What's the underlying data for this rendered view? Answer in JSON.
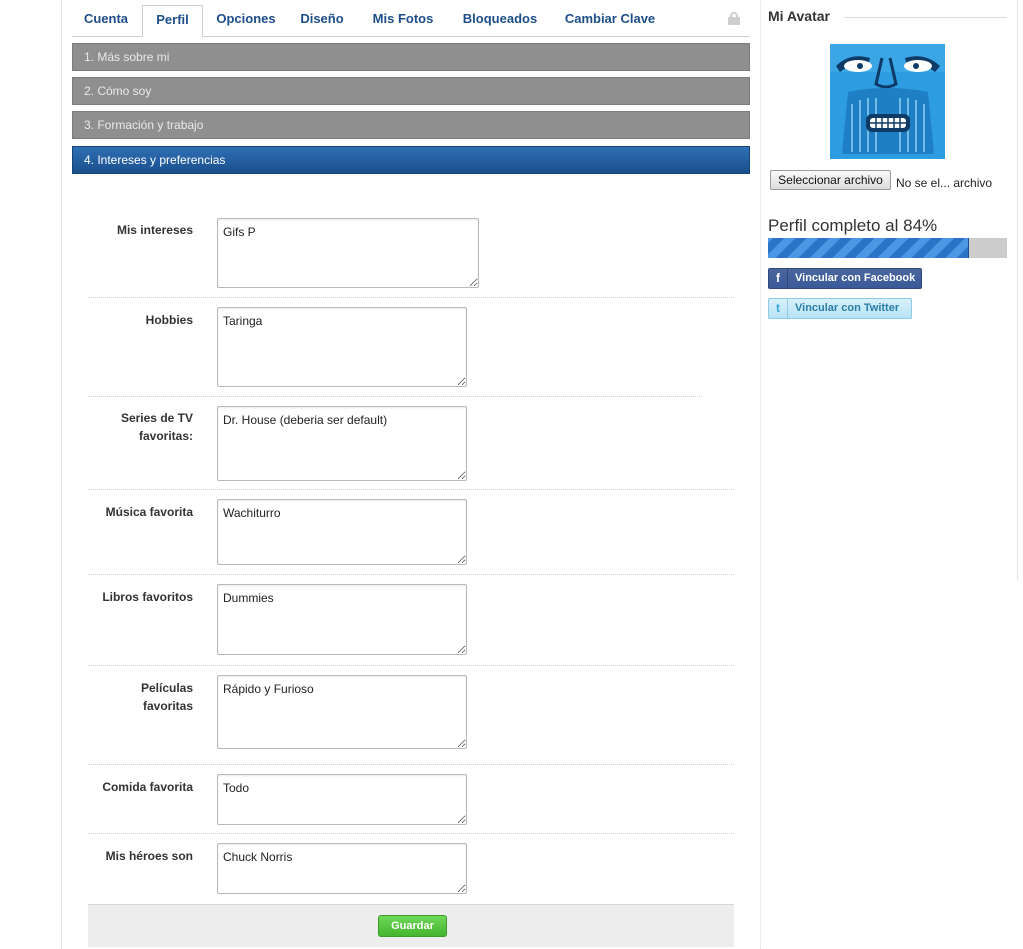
{
  "tabs": [
    {
      "label": "Cuenta"
    },
    {
      "label": "Perfil",
      "active": true
    },
    {
      "label": "Opciones"
    },
    {
      "label": "Diseño"
    },
    {
      "label": "Mis Fotos"
    },
    {
      "label": "Bloqueados"
    },
    {
      "label": "Cambiar Clave"
    }
  ],
  "accordion": [
    {
      "label": "1. Más sobre mi"
    },
    {
      "label": "2. Cómo soy"
    },
    {
      "label": "3. Formación y trabajo"
    },
    {
      "label": "4. Intereses y preferencias",
      "open": true
    }
  ],
  "form": {
    "fields": [
      {
        "label": "Mis intereses",
        "value": "Gifs P"
      },
      {
        "label": "Hobbies",
        "value": "Taringa"
      },
      {
        "label": "Series de TV favoritas:",
        "value": "Dr. House (deberia ser default)"
      },
      {
        "label": "Música favorita",
        "value": "Wachiturro"
      },
      {
        "label": "Libros favoritos",
        "value": "Dummies"
      },
      {
        "label": "Películas favoritas",
        "value": "Rápido y Furioso"
      },
      {
        "label": "Comida favorita",
        "value": "Todo"
      },
      {
        "label": "Mis héroes son",
        "value": "Chuck Norris"
      }
    ],
    "save_label": "Guardar"
  },
  "sidebar": {
    "title": "Mi Avatar",
    "file_button": "Seleccionar archivo",
    "file_status": "No se el... archivo",
    "progress_label": "Perfil completo al 84%",
    "progress_fraction": 0.84,
    "facebook_label": "Vincular con Facebook",
    "twitter_label": "Vincular con Twitter"
  },
  "colors": {
    "tab_text": "#1d4e89",
    "accordion_closed": "#8f8f8f",
    "accordion_open": "#1b4f8e",
    "save_green": "#44b52e",
    "avatar_blue": "#2d9ce0",
    "facebook": "#3b5998"
  },
  "icons": [
    "lock-icon",
    "avatar-image",
    "facebook-icon",
    "twitter-icon"
  ]
}
